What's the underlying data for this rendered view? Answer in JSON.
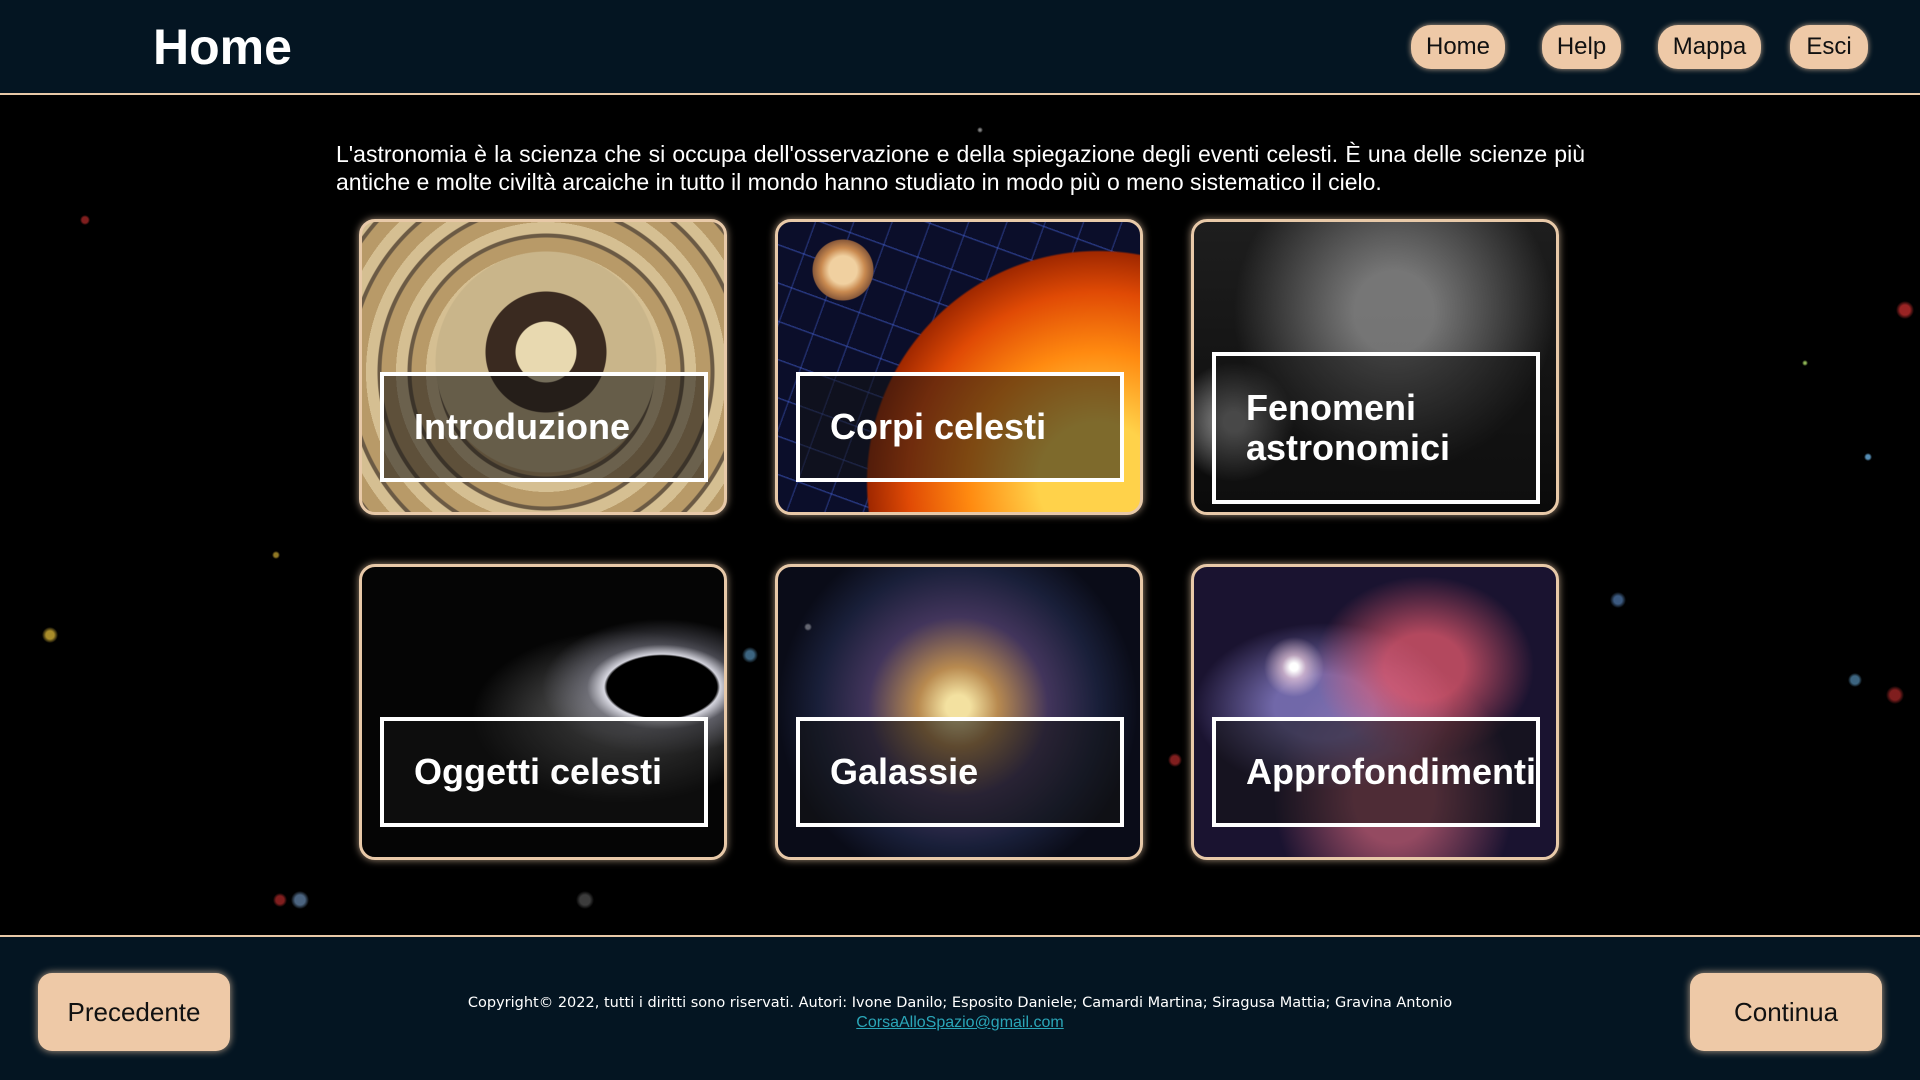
{
  "header": {
    "title": "Home",
    "nav": [
      {
        "label": "Home"
      },
      {
        "label": "Help"
      },
      {
        "label": "Mappa"
      },
      {
        "label": "Esci"
      }
    ]
  },
  "intro": {
    "text": "L'astronomia è la scienza che si occupa dell'osservazione e della spiegazione degli eventi celesti. È una delle scienze più antiche e molte civiltà arcaiche in tutto il mondo hanno studiato in modo più o meno sistematico il cielo."
  },
  "cards": [
    {
      "label": "Introduzione",
      "image": "armillary-chart-image"
    },
    {
      "label": "Corpi celesti",
      "image": "sun-and-jupiter-image"
    },
    {
      "label": "Fenomeni astronomici",
      "image": "starry-sky-image"
    },
    {
      "label": "Oggetti celesti",
      "image": "black-hole-image"
    },
    {
      "label": "Galassie",
      "image": "spiral-galaxy-image"
    },
    {
      "label": "Approfondimenti",
      "image": "nebula-image"
    }
  ],
  "footer": {
    "prev_label": "Precedente",
    "next_label": "Continua",
    "copyright": "Copyright© 2022, tutti i diritti sono riservati. Autori: Ivone Danilo; Esposito Daniele; Camardi Martina; Siragusa Mattia; Gravina Antonio",
    "email": "CorsaAlloSpazio@gmail.com"
  },
  "colors": {
    "header_bg": "#041522",
    "button_bg": "#eec9a7",
    "border": "#e8c9a8",
    "link": "#2aa6b8"
  }
}
